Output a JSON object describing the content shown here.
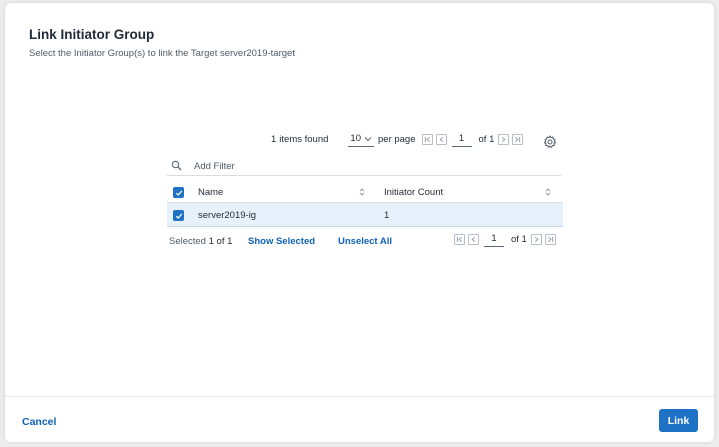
{
  "dialog": {
    "title": "Link Initiator Group",
    "subtitle": "Select the Initiator Group(s) to link the Target server2019-target"
  },
  "pager_top": {
    "items_count": "1",
    "items_found_label": "items found",
    "per_page_value": "10",
    "per_page_label": "per page",
    "page_value": "1",
    "of_pages": "of 1"
  },
  "filter": {
    "placeholder": "Add Filter"
  },
  "table": {
    "columns": [
      "Name",
      "Initiator Count"
    ],
    "rows": [
      {
        "selected": true,
        "name": "server2019-ig",
        "initiator_count": "1"
      }
    ]
  },
  "footer": {
    "selected_label": "Selected",
    "selected_value": "1 of 1",
    "show_selected": "Show Selected",
    "unselect_all": "Unselect All"
  },
  "pager_bottom": {
    "page_value": "1",
    "of_pages": "of 1"
  },
  "actions": {
    "cancel": "Cancel",
    "link": "Link"
  },
  "colors": {
    "accent": "#1d72c6",
    "link_text": "#0d62b8",
    "selected_row": "#e6f1fb"
  }
}
